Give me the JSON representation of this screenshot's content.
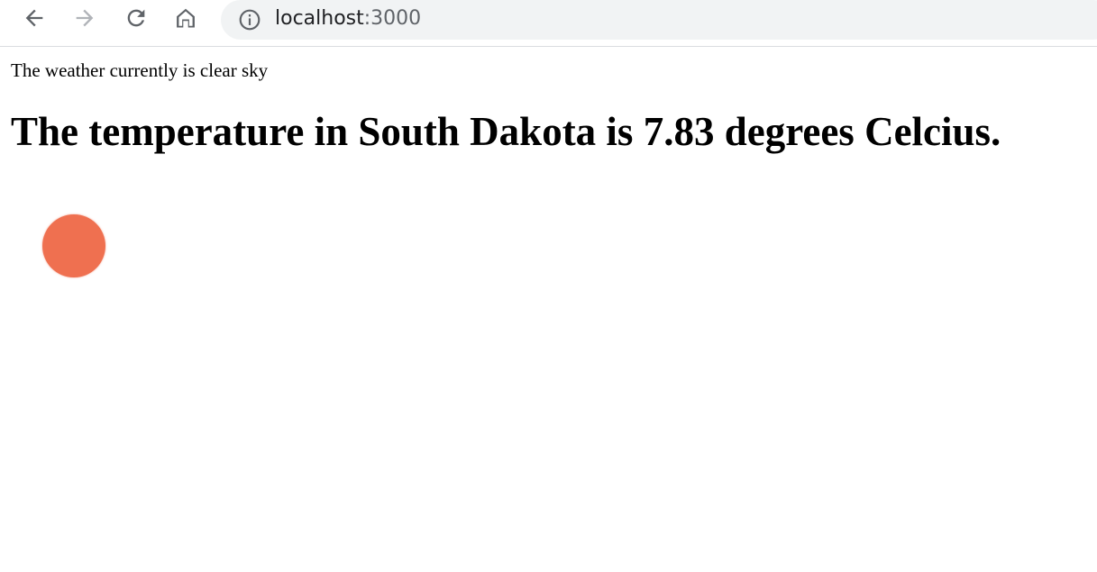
{
  "browser": {
    "url_host": "localhost",
    "url_port": ":3000",
    "back_icon": "arrow-left-icon",
    "forward_icon": "arrow-right-icon",
    "reload_icon": "reload-icon",
    "home_icon": "home-icon",
    "site_info_icon": "info-icon"
  },
  "page": {
    "weather_line": "The weather currently is clear sky",
    "temperature_heading": "The temperature in South Dakota is 7.83 degrees Celcius.",
    "sun_color": "#ef7050"
  }
}
